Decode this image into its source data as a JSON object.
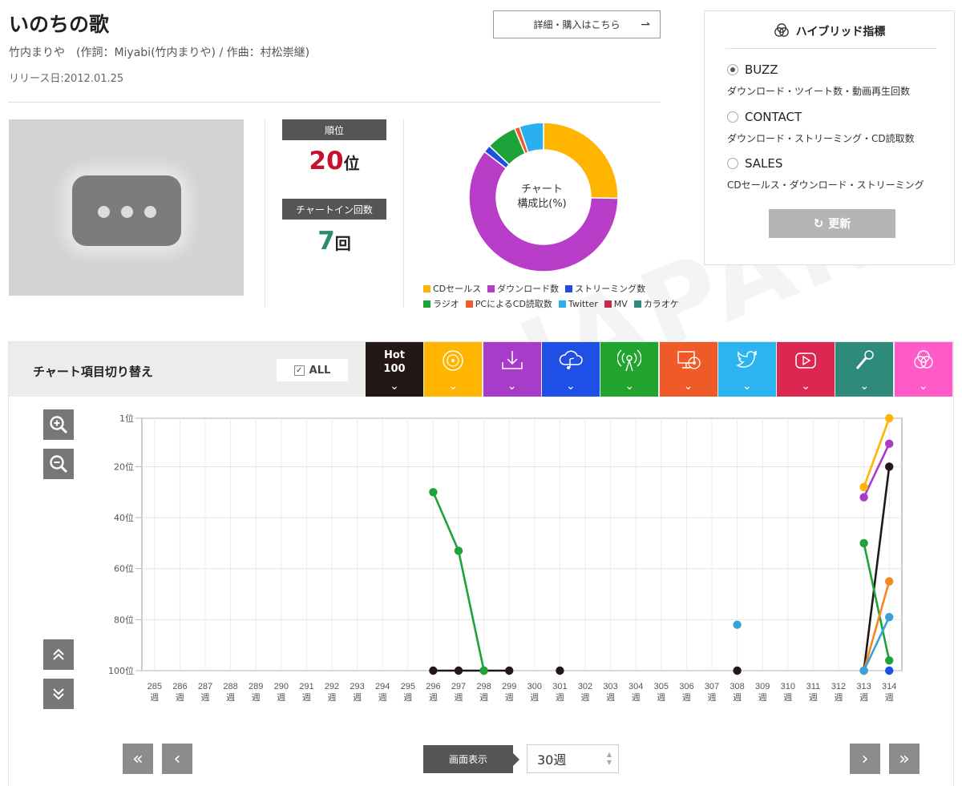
{
  "song": {
    "title": "いのちの歌",
    "credit": "竹内まりや　(作詞：Miyabi(竹内まりや) / 作曲：村松崇継)",
    "release": "リリース日:2012.01.25",
    "detail_button": "詳細・購入はこちら",
    "detail_arrow": "⇀"
  },
  "stats": {
    "rank_label": "順位",
    "rank_value": "20",
    "rank_unit": "位",
    "chartin_label": "チャートイン回数",
    "chartin_value": "7",
    "chartin_unit": "回",
    "rank_color": "#c8102e",
    "chartin_color": "#2e8b6b"
  },
  "composition": {
    "center_label_1": "チャート",
    "center_label_2": "構成比(%)",
    "slices": [
      {
        "name": "CDセールス",
        "value": 25,
        "color": "#ffb400"
      },
      {
        "name": "ダウンロード数",
        "value": 59.6,
        "color": "#b73cc8"
      },
      {
        "name": "ストリーミング数",
        "value": 1.6,
        "color": "#1e4fe0"
      },
      {
        "name": "ラジオ",
        "value": 6.5,
        "color": "#1ea23a"
      },
      {
        "name": "PCによるCD読取数",
        "value": 1.1,
        "color": "#f05a28"
      },
      {
        "name": "Twitter",
        "value": 5.2,
        "color": "#2ab0f0"
      },
      {
        "name": "MV",
        "value": 0,
        "color": "#c8284a"
      },
      {
        "name": "カラオケ",
        "value": 0,
        "color": "#2e8b7b"
      }
    ]
  },
  "hybrid": {
    "title": "ハイブリッド指標",
    "options": [
      {
        "label": "BUZZ",
        "desc": "ダウンロード・ツイート数・動画再生回数",
        "selected": true
      },
      {
        "label": "CONTACT",
        "desc": "ダウンロード・ストリーミング・CD読取数",
        "selected": false
      },
      {
        "label": "SALES",
        "desc": "CDセールス・ダウンロード・ストリーミング",
        "selected": false
      }
    ],
    "refresh_label": "更新"
  },
  "switcher": {
    "title": "チャート項目切り替え",
    "all_label": "ALL",
    "hot_label_1": "Hot",
    "hot_label_2": "100",
    "categories": [
      {
        "name": "hot100",
        "color": "#231815"
      },
      {
        "name": "cd-sales",
        "color": "#ffb400",
        "icon": "cd-icon"
      },
      {
        "name": "download",
        "color": "#a83cc8",
        "icon": "download-icon"
      },
      {
        "name": "streaming",
        "color": "#1e50e6",
        "icon": "cloud-music-icon"
      },
      {
        "name": "radio",
        "color": "#22a52e",
        "icon": "radio-icon"
      },
      {
        "name": "pc-cd-read",
        "color": "#f05a28",
        "icon": "pc-cd-icon"
      },
      {
        "name": "twitter",
        "color": "#2ab4f0",
        "icon": "twitter-icon"
      },
      {
        "name": "mv",
        "color": "#dc2850",
        "icon": "youtube-icon"
      },
      {
        "name": "karaoke",
        "color": "#2e8b7b",
        "icon": "microphone-icon"
      },
      {
        "name": "hybrid",
        "color": "#ff5ac8",
        "icon": "hybrid-icon"
      }
    ]
  },
  "footer": {
    "display_label": "画面表示",
    "display_value": "30週"
  },
  "chart_data": {
    "type": "line",
    "x": [
      285,
      286,
      287,
      288,
      289,
      290,
      291,
      292,
      293,
      294,
      295,
      296,
      297,
      298,
      299,
      300,
      301,
      302,
      303,
      304,
      305,
      306,
      307,
      308,
      309,
      310,
      311,
      312,
      313,
      314
    ],
    "x_unit": "週",
    "y_ticks": [
      "1位",
      "20位",
      "40位",
      "60位",
      "80位",
      "100位"
    ],
    "ylim": [
      1,
      100
    ],
    "y_inverted": true,
    "series": [
      {
        "name": "Hot 100",
        "color": "#231815",
        "points": [
          [
            296,
            100
          ],
          [
            297,
            100
          ],
          [
            298,
            100
          ],
          [
            299,
            100
          ],
          [
            301,
            100
          ],
          [
            308,
            100
          ],
          [
            313,
            100
          ],
          [
            314,
            20
          ]
        ]
      },
      {
        "name": "CDセールス",
        "color": "#ffb400",
        "points": [
          [
            313,
            28
          ],
          [
            314,
            1
          ]
        ]
      },
      {
        "name": "ダウンロード数",
        "color": "#a83cc8",
        "points": [
          [
            313,
            32
          ],
          [
            314,
            11
          ]
        ]
      },
      {
        "name": "ストリーミング数",
        "color": "#1e50e6",
        "points": [
          [
            314,
            100
          ]
        ]
      },
      {
        "name": "ラジオ",
        "color": "#1ea23a",
        "points": [
          [
            296,
            30
          ],
          [
            297,
            53
          ],
          [
            298,
            100
          ],
          [
            313,
            50
          ],
          [
            314,
            96
          ]
        ]
      },
      {
        "name": "PCによるCD読取数",
        "color": "#f08a1e",
        "points": [
          [
            313,
            100
          ],
          [
            314,
            65
          ]
        ]
      },
      {
        "name": "Twitter",
        "color": "#3aa0d8",
        "points": [
          [
            308,
            82
          ],
          [
            313,
            100
          ],
          [
            314,
            79
          ]
        ]
      }
    ]
  }
}
